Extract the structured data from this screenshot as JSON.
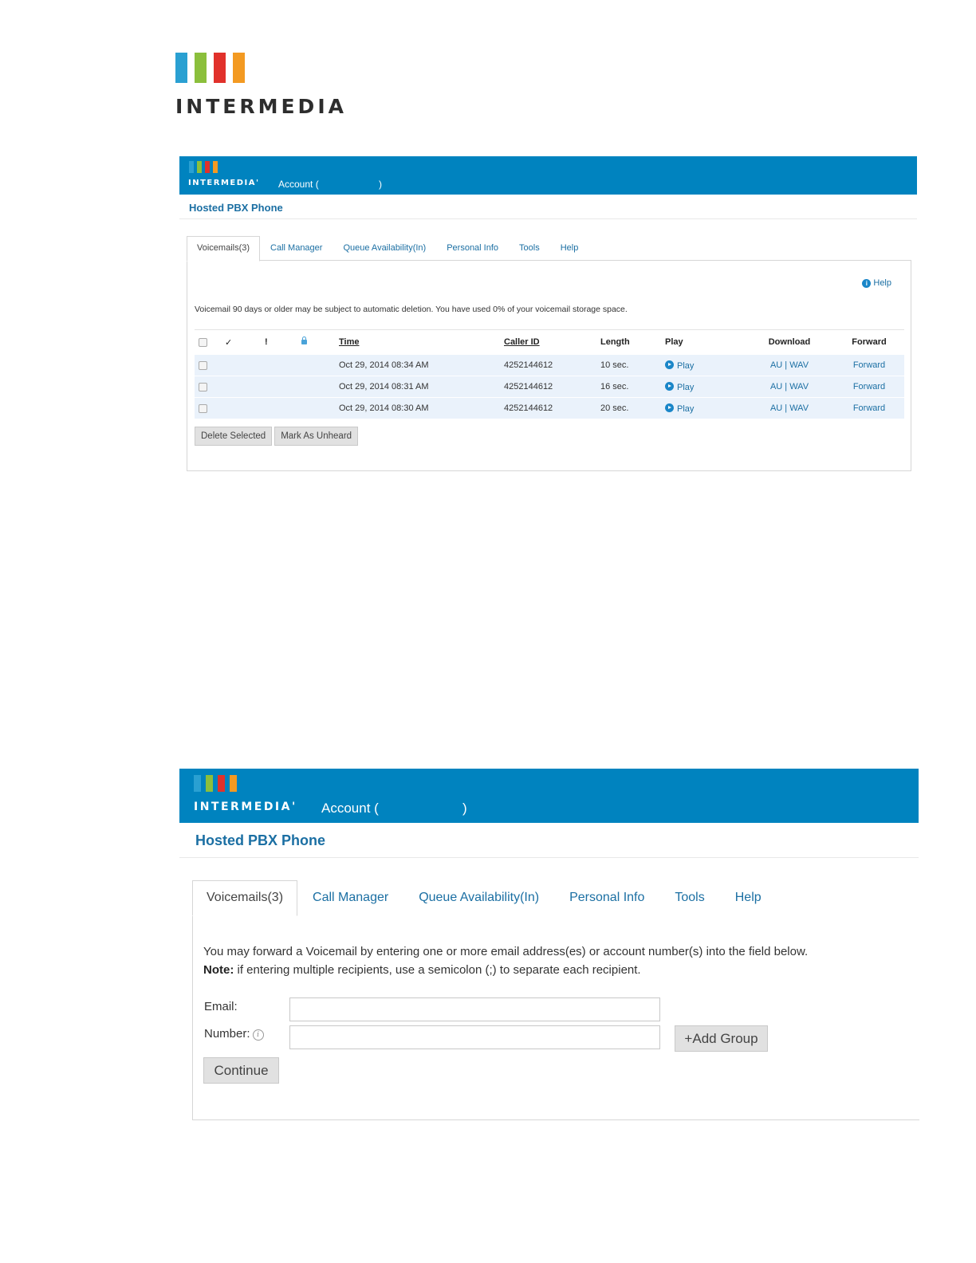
{
  "logo": {
    "wordmark": "INTERMEDIA"
  },
  "colors": {
    "bar_blue": "#2aa0d2",
    "bar_green": "#8bbf3c",
    "bar_red": "#e1312b",
    "bar_orange": "#f39a22",
    "header": "#0083bf",
    "link": "#1b6fa3"
  },
  "voicemail_screen": {
    "brand": "INTERMEDIA'",
    "account_label": "Account (",
    "account_close": ")",
    "section_title": "Hosted PBX Phone",
    "tabs": [
      "Voicemails(3)",
      "Call Manager",
      "Queue Availability(In)",
      "Personal Info",
      "Tools",
      "Help"
    ],
    "help_link": "Help",
    "notice": "Voicemail 90 days or older may be subject to automatic deletion. You have used 0% of your voicemail storage space.",
    "columns": {
      "check": "✓",
      "urgent": "!",
      "lock": "lock-icon",
      "time": "Time",
      "caller_id": "Caller ID",
      "length": "Length",
      "play": "Play",
      "download": "Download",
      "forward": "Forward"
    },
    "rows": [
      {
        "time": "Oct 29, 2014 08:34 AM",
        "caller_id": "4252144612",
        "length": "10 sec.",
        "play": "Play",
        "au": "AU",
        "divider": "|",
        "wav": "WAV",
        "forward": "Forward"
      },
      {
        "time": "Oct 29, 2014 08:31 AM",
        "caller_id": "4252144612",
        "length": "16 sec.",
        "play": "Play",
        "au": "AU",
        "divider": "|",
        "wav": "WAV",
        "forward": "Forward"
      },
      {
        "time": "Oct 29, 2014 08:30 AM",
        "caller_id": "4252144612",
        "length": "20 sec.",
        "play": "Play",
        "au": "AU",
        "divider": "|",
        "wav": "WAV",
        "forward": "Forward"
      }
    ],
    "buttons": {
      "delete": "Delete Selected",
      "mark_unheard": "Mark As Unheard"
    }
  },
  "forward_screen": {
    "brand": "INTERMEDIA'",
    "account_label": "Account (",
    "account_close": ")",
    "section_title": "Hosted PBX Phone",
    "tabs": [
      "Voicemails(3)",
      "Call Manager",
      "Queue Availability(In)",
      "Personal Info",
      "Tools",
      "Help"
    ],
    "intro": "You may forward a Voicemail by entering one or more email address(es) or account number(s) into the field below.",
    "note_label": "Note:",
    "note_text": " if entering multiple recipients, use a semicolon (;) to separate each recipient.",
    "email_label": "Email:",
    "email_value": "",
    "number_label": "Number:",
    "number_info": "i",
    "number_value": "",
    "add_group": "+Add Group",
    "continue": "Continue"
  }
}
